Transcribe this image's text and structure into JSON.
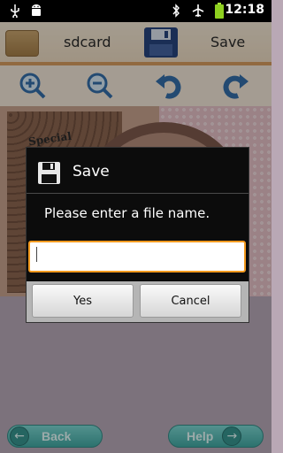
{
  "status_bar": {
    "time": "12:18",
    "icons": [
      "usb-icon",
      "android-icon",
      "bluetooth-icon",
      "airplane-mode-icon",
      "battery-icon"
    ]
  },
  "top_bar": {
    "folder_label": "sdcard",
    "save_label": "Save"
  },
  "toolbar": {
    "tools": [
      "zoom-in-icon",
      "zoom-out-icon",
      "undo-icon",
      "redo-icon"
    ]
  },
  "canvas": {
    "decor_text": "Special"
  },
  "bottom": {
    "back_label": "Back",
    "help_label": "Help"
  },
  "dialog": {
    "title": "Save",
    "message": "Please enter a file name.",
    "input_value": "",
    "input_placeholder": "",
    "yes_label": "Yes",
    "cancel_label": "Cancel"
  },
  "colors": {
    "input_focus_border": "#f39a1f",
    "toolbar_icon_blue": "#2d6aa8",
    "bottom_button_teal": "#3aa8a2"
  }
}
